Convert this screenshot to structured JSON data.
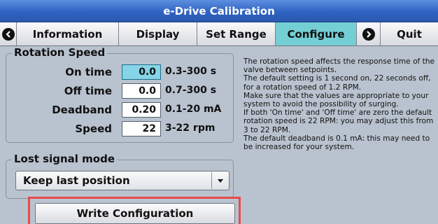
{
  "window": {
    "title": "e-Drive Calibration"
  },
  "tabs": [
    {
      "label": "Information"
    },
    {
      "label": "Display"
    },
    {
      "label": "Set Range"
    },
    {
      "label": "Configure",
      "active": true
    },
    {
      "label": "Quit"
    }
  ],
  "rotation_speed": {
    "title": "Rotation Speed",
    "rows": [
      {
        "label": "On time",
        "value": "0.0",
        "range": "0.3-300 s"
      },
      {
        "label": "Off time",
        "value": "0.0",
        "range": "0.7-300 s"
      },
      {
        "label": "Deadband",
        "value": "0.20",
        "range": "0.1-20 mA"
      },
      {
        "label": "Speed",
        "value": "22",
        "range": "3-22 rpm"
      }
    ]
  },
  "lost_signal": {
    "title": "Lost signal mode",
    "selected": "Keep last position"
  },
  "write_button": {
    "label": "Write Configuration"
  },
  "help": {
    "paragraphs": [
      "The rotation speed affects the response time of the valve between setpoints.",
      "The default setting is 1 second on, 22 seconds off, for a rotation speed of 1.2 RPM.",
      "Make sure that the values are appropriate to your system to avoid the possibility of surging.",
      "If both 'On time' and 'Off time' are zero the default rotation speed is 22 RPM: you may adjust this from 3 to 22 RPM.",
      "The default deadband is 0.1 mA: this may need to be increased for your system."
    ]
  },
  "colors": {
    "title_bar": "#2f63c2",
    "active_tab": "#73cfd4",
    "focused_field": "#86d4e7",
    "highlight": "#e84a4a",
    "background": "#b9c3cf"
  }
}
